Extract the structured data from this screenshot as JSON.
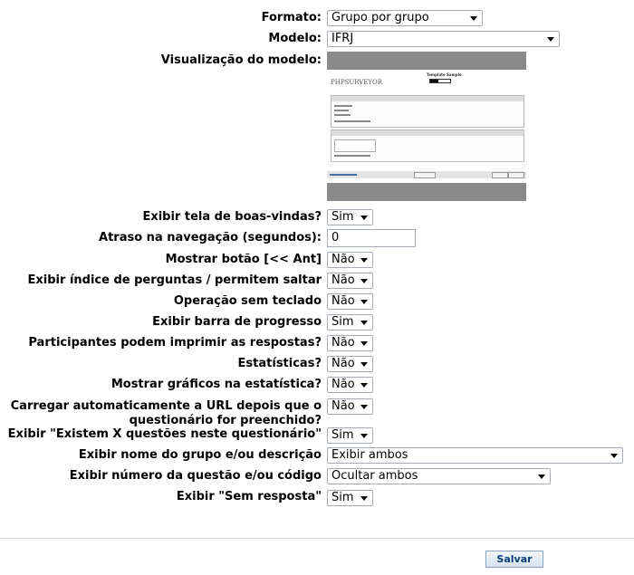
{
  "form": {
    "formato": {
      "label": "Formato:",
      "value": "Grupo por grupo"
    },
    "modelo": {
      "label": "Modelo:",
      "value": "IFRJ"
    },
    "visualizacao": {
      "label": "Visualização do modelo:"
    },
    "boas_vindas": {
      "label": "Exibir tela de boas-vindas?",
      "value": "Sim"
    },
    "atraso": {
      "label": "Atraso na navegação (segundos):",
      "value": "0"
    },
    "botao_ant": {
      "label": "Mostrar botão [<< Ant]",
      "value": "Não"
    },
    "indice": {
      "label": "Exibir índice de perguntas / permitem saltar",
      "value": "Não"
    },
    "sem_teclado": {
      "label": "Operação sem teclado",
      "value": "Não"
    },
    "barra_progresso": {
      "label": "Exibir barra de progresso",
      "value": "Sim"
    },
    "imprimir": {
      "label": "Participantes podem imprimir as respostas?",
      "value": "Não"
    },
    "estatisticas": {
      "label": "Estatísticas?",
      "value": "Não"
    },
    "graficos": {
      "label": "Mostrar gráficos na estatística?",
      "value": "Não"
    },
    "carregar_url": {
      "label": "Carregar automaticamente a URL depois que o questionário for preenchido?",
      "value": "Não"
    },
    "existem_x": {
      "label": "Exibir \"Existem X questões neste questionário\"",
      "value": "Sim"
    },
    "nome_grupo": {
      "label": "Exibir nome do grupo e/ou descrição",
      "value": "Exibir ambos"
    },
    "numero_questao": {
      "label": "Exibir número da questão e/ou código",
      "value": "Ocultar ambos"
    },
    "sem_resposta": {
      "label": "Exibir \"Sem resposta\"",
      "value": "Sim"
    }
  },
  "preview": {
    "logo": "PHPSURVEYOR",
    "title": "Template Sample"
  },
  "actions": {
    "save_label": "Salvar"
  }
}
